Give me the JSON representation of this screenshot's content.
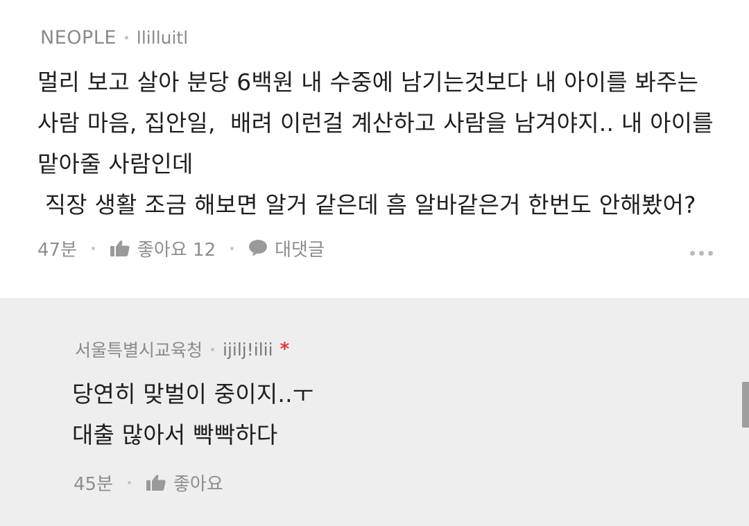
{
  "comment": {
    "author": "NEOPLE",
    "username": "llilluitl",
    "body": "멀리 보고 살아 분당 6백원 내 수중에 남기는것보다 내 아이를 봐주는\n사람 마음, 집안일,  배려 이런걸 계산하고 사람을 남겨야지.. 내 아이를\n맡아줄 사람인데\n 직장 생활 조금 해보면 알거 같은데 흠 알바같은거 한번도 안해봤어?",
    "time": "47분",
    "like_label": "좋아요 12",
    "reply_label": "대댓글",
    "icons": {
      "like": "thumbs-up-icon",
      "reply": "speech-bubble-icon",
      "more": "more-dots-icon"
    }
  },
  "reply": {
    "author": "서울특별시교육청",
    "username": "ijilj!ilii",
    "marker": "*",
    "body": "당연히 맞벌이 중이지..ㅜ\n대출 많아서 빡빡하다",
    "time": "45분",
    "like_label": "좋아요",
    "icons": {
      "like": "thumbs-up-icon"
    }
  },
  "colors": {
    "reply_background": "#eeeeef",
    "meta_text": "#8a8a8a",
    "marker": "#e53935",
    "body_text": "#1f1f1f"
  }
}
